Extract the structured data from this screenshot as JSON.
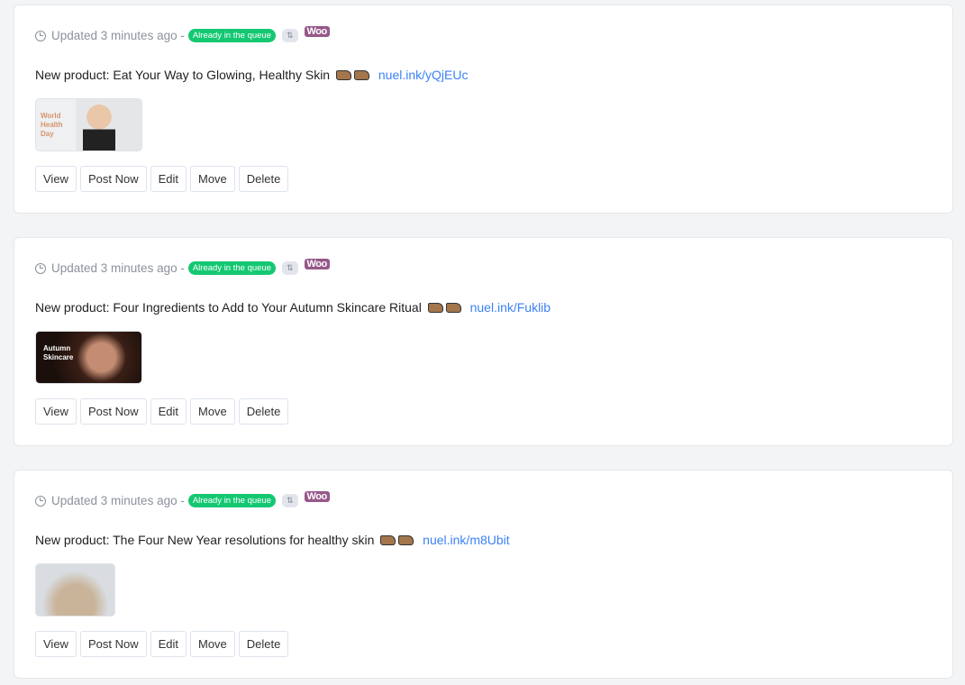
{
  "posts": [
    {
      "updated": "Updated 3 minutes ago -",
      "badge": "Already in the queue",
      "switch_icon": "⇅",
      "woo": "Woo",
      "text": "New product: Eat Your Way to Glowing, Healthy Skin",
      "link": "nuel.ink/yQjEUc",
      "thumb_text": "World Health Day"
    },
    {
      "updated": "Updated 3 minutes ago -",
      "badge": "Already in the queue",
      "switch_icon": "⇅",
      "woo": "Woo",
      "text": "New product: Four Ingredients to Add to Your Autumn Skincare Ritual",
      "link": "nuel.ink/Fuklib",
      "thumb_text": "Autumn Skincare"
    },
    {
      "updated": "Updated 3 minutes ago -",
      "badge": "Already in the queue",
      "switch_icon": "⇅",
      "woo": "Woo",
      "text": "New product: The Four New Year resolutions for healthy skin",
      "link": "nuel.ink/m8Ubit"
    }
  ],
  "actions": {
    "view": "View",
    "post_now": "Post Now",
    "edit": "Edit",
    "move": "Move",
    "delete": "Delete"
  },
  "colors": {
    "badge": "#14c872",
    "link": "#3b82f6",
    "woo": "#96588a"
  }
}
